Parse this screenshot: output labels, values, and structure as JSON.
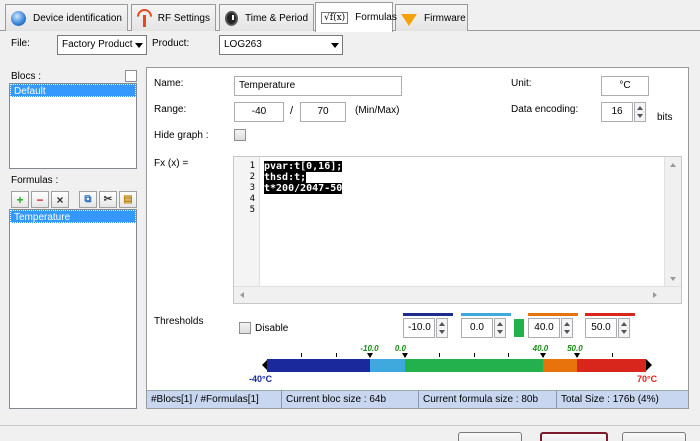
{
  "tabs": [
    {
      "label": "Device identification",
      "icon": "globe-icon"
    },
    {
      "label": "RF Settings",
      "icon": "antenna-icon"
    },
    {
      "label": "Time & Period",
      "icon": "clock-icon"
    },
    {
      "label": "Formulas",
      "icon": "sqrt-function-icon",
      "glyph": "√f(x)",
      "active": true
    },
    {
      "label": "Firmware",
      "icon": "download-arrow-icon"
    }
  ],
  "top": {
    "file_label": "File:",
    "file_value": "Factory Product",
    "product_label": "Product:",
    "product_value": "LOG263"
  },
  "left": {
    "blocs_label": "Blocs :",
    "blocs_items": [
      "Default"
    ],
    "formulas_label": "Formulas :",
    "formulas_items": [
      "Temperature"
    ]
  },
  "formula": {
    "name_label": "Name:",
    "name_value": "Temperature",
    "unit_label": "Unit:",
    "unit_value": "°C",
    "range_label": "Range:",
    "range_min": "-40",
    "range_sep": "/",
    "range_max": "70",
    "range_hint": "(Min/Max)",
    "encoding_label": "Data encoding:",
    "encoding_value": "16",
    "encoding_unit": "bits",
    "hide_graph_label": "Hide graph :",
    "fx_label": "Fx (x) =",
    "code_lines": [
      "pvar:t[0,16];",
      "thsd:t;",
      "t*200/2047-50",
      "",
      ""
    ],
    "line_numbers": [
      "1",
      "2",
      "3",
      "4",
      "5"
    ]
  },
  "thresholds": {
    "label": "Thresholds",
    "disable_label": "Disable",
    "values": [
      "-10.0",
      "0.0",
      "40.0",
      "50.0"
    ],
    "colors": [
      "#1f2c8f",
      "#3fa9dd",
      "#e8730c",
      "#d9261c"
    ],
    "indicator_color": "#22b14c",
    "min_label": "-40°C",
    "max_label": "70°C",
    "marker_labels": [
      "-10.0",
      "0.0",
      "40.0",
      "50.0"
    ],
    "range_min": -40,
    "range_max": 70
  },
  "status": {
    "counts": "#Blocs[1] / #Formulas[1]",
    "bloc_size": "Current bloc size : 64b",
    "formula_size": "Current formula size : 80b",
    "total_size": "Total Size : 176b (4%)"
  },
  "colors": {
    "selection": "#3399ff",
    "status_bg": "#c8d6f0",
    "min_color": "#1a2a9c",
    "max_color": "#e0201a"
  }
}
